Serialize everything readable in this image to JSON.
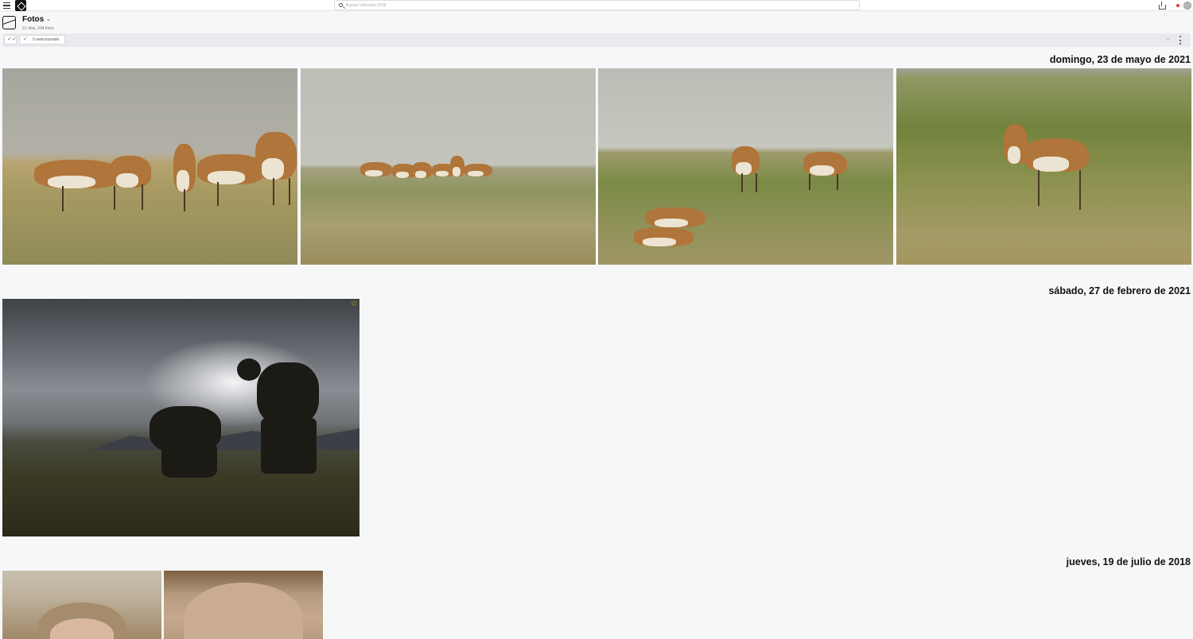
{
  "search": {
    "placeholder": "Buscar Unknown 2018"
  },
  "header": {
    "title": "Fotos",
    "subtitle": "21 días, 204 fotos"
  },
  "toolbar": {
    "selected_label": "0 seleccionado"
  },
  "sections": [
    {
      "date": "domingo, 23 de mayo de 2021"
    },
    {
      "date": "sábado, 27 de febrero de 2021"
    },
    {
      "date": "jueves, 19 de julio de 2018"
    }
  ],
  "icons": {
    "menu": "menu-icon",
    "logo": "app-logo",
    "search": "search-icon",
    "share": "share-icon",
    "album": "album-icon",
    "check_all": "double-check-icon",
    "check": "check-icon",
    "add": "plus-icon",
    "more": "kebab-icon",
    "favorite": "star-icon"
  },
  "colors": {
    "favorite_star": "#f0c419",
    "record_dot": "#e53935"
  }
}
